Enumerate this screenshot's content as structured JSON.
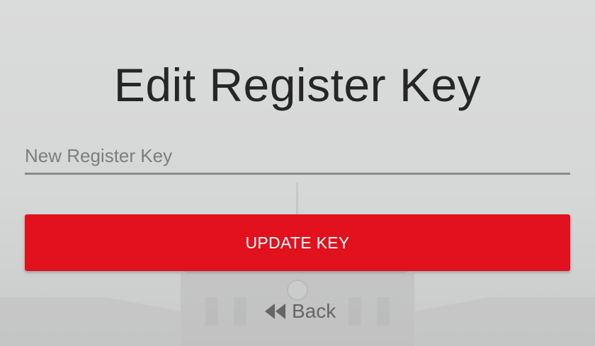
{
  "page": {
    "title": "Edit Register Key"
  },
  "form": {
    "register_key": {
      "value": "",
      "placeholder": "New Register Key"
    },
    "submit_label": "UPDATE KEY"
  },
  "nav": {
    "back_label": "Back",
    "back_icon": "fast-backward-icon"
  },
  "colors": {
    "accent": "#e2111e",
    "background": "#d6d7d7",
    "title_text": "#262626",
    "muted_text": "#666666"
  }
}
